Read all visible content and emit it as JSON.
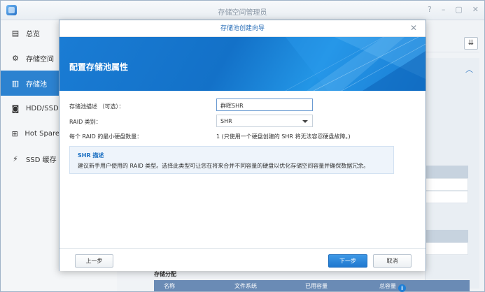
{
  "window": {
    "title": "存储空间管理员",
    "controls": [
      "?",
      "–",
      "▢",
      "✕"
    ]
  },
  "sidebar": {
    "items": [
      {
        "label": "总览",
        "icon": "overview-icon",
        "active": false
      },
      {
        "label": "存储空间",
        "icon": "storage-space-icon",
        "active": false
      },
      {
        "label": "存储池",
        "icon": "storage-pool-icon",
        "active": true
      },
      {
        "label": "HDD/SSD",
        "icon": "hdd-icon",
        "active": false
      },
      {
        "label": "Hot Spare",
        "icon": "hot-spare-icon",
        "active": false
      },
      {
        "label": "SSD 缓存",
        "icon": "ssd-cache-icon",
        "active": false
      }
    ]
  },
  "background": {
    "storage_allocation_title": "存储分配",
    "table_headers": [
      "名称",
      "文件系统",
      "已用容量",
      "总容量"
    ]
  },
  "dialog": {
    "title": "存储池创建向导",
    "banner_title": "配置存储池属性",
    "fields": {
      "description_label": "存储池描述 （可选）：",
      "description_value": "群晖SHR",
      "raid_type_label": "RAID 类别：",
      "raid_type_value": "SHR",
      "min_disks_label": "每个 RAID 的最小硬盘数量：",
      "min_disks_value": "1 (只使用一个硬盘创建的 SHR 将无法容忍硬盘故障。)"
    },
    "info_box": {
      "title": "SHR 描述",
      "description": "建议新手用户使用的 RAID 类型。选择此类型可让您在将来合并不同容量的硬盘以优化存储空间容量并确保数据冗余。"
    },
    "buttons": {
      "prev": "上一步",
      "next": "下一步",
      "cancel": "取消"
    }
  },
  "colors": {
    "accent": "#2c82d0",
    "banner": "#1a7cd4",
    "primary_button": "#1f78cf"
  }
}
